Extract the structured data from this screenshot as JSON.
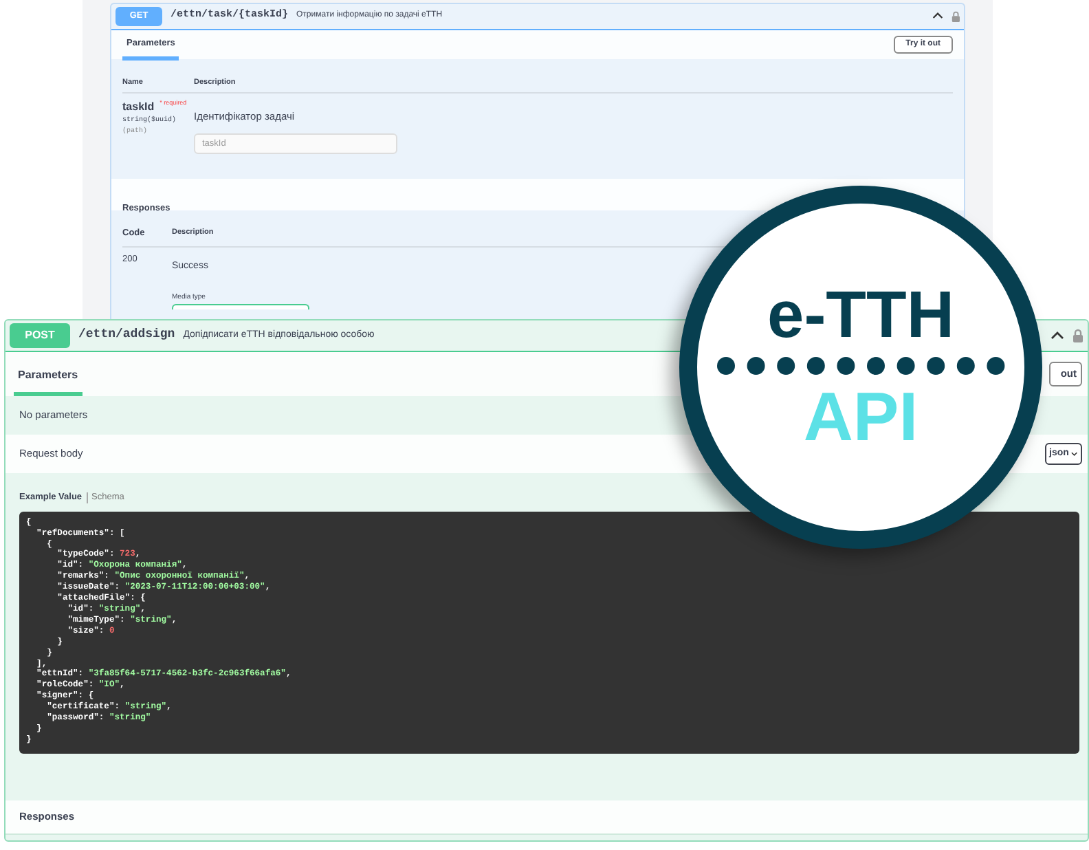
{
  "get_operation": {
    "kind": "get",
    "method": "GET",
    "path": "/ettn/task/{taskId}",
    "summary": "Отримати інформацію по задачі еТТН",
    "tab": {
      "label": "Parameters",
      "selected": true
    },
    "try_button": "Try it out",
    "param_columns": [
      "Name",
      "Description"
    ],
    "parameters": [
      {
        "name": "taskId",
        "required": "* required",
        "type": "string($uuid)",
        "location": "(path)",
        "description": "Ідентифікатор задачі",
        "placeholder": "taskId"
      }
    ],
    "responses_title": "Responses",
    "response_columns": [
      "Code",
      "Description"
    ],
    "responses": [
      {
        "code": "200",
        "description": "Success",
        "media_type_label": "Media type"
      }
    ]
  },
  "post_operation": {
    "kind": "post",
    "method": "POST",
    "path": "/ettn/addsign",
    "summary": "Допідписати еТТН відповідальною особою",
    "tab": {
      "label": "Parameters",
      "selected": true
    },
    "try_button": "out",
    "no_parameters": "No parameters",
    "request_body_title": "Request body",
    "content_type": "json",
    "example_tabs": [
      {
        "label": "Example Value",
        "selected": true
      },
      {
        "label": "Schema",
        "selected": false
      }
    ],
    "code_lines": [
      [
        {
          "kind": "plain",
          "text": "{"
        }
      ],
      [
        {
          "kind": "plain",
          "text": "  \"refDocuments\": ["
        }
      ],
      [
        {
          "kind": "plain",
          "text": "    {"
        }
      ],
      [
        {
          "kind": "plain",
          "text": "      \"typeCode\": "
        },
        {
          "kind": "number",
          "text": "723"
        },
        {
          "kind": "plain",
          "text": ","
        }
      ],
      [
        {
          "kind": "plain",
          "text": "      \"id\": "
        },
        {
          "kind": "string",
          "text": "\"Охорона компанія\""
        },
        {
          "kind": "plain",
          "text": ","
        }
      ],
      [
        {
          "kind": "plain",
          "text": "      \"remarks\": "
        },
        {
          "kind": "string",
          "text": "\"Опис охоронної компанії\""
        },
        {
          "kind": "plain",
          "text": ","
        }
      ],
      [
        {
          "kind": "plain",
          "text": "      \"issueDate\": "
        },
        {
          "kind": "string",
          "text": "\"2023-07-11T12:00:00+03:00\""
        },
        {
          "kind": "plain",
          "text": ","
        }
      ],
      [
        {
          "kind": "plain",
          "text": "      \"attachedFile\": {"
        }
      ],
      [
        {
          "kind": "plain",
          "text": "        \"id\": "
        },
        {
          "kind": "string",
          "text": "\"string\""
        },
        {
          "kind": "plain",
          "text": ","
        }
      ],
      [
        {
          "kind": "plain",
          "text": "        \"mimeType\": "
        },
        {
          "kind": "string",
          "text": "\"string\""
        },
        {
          "kind": "plain",
          "text": ","
        }
      ],
      [
        {
          "kind": "plain",
          "text": "        \"size\": "
        },
        {
          "kind": "number",
          "text": "0"
        }
      ],
      [
        {
          "kind": "plain",
          "text": "      }"
        }
      ],
      [
        {
          "kind": "plain",
          "text": "    }"
        }
      ],
      [
        {
          "kind": "plain",
          "text": "  ],"
        }
      ],
      [
        {
          "kind": "plain",
          "text": "  \"ettnId\": "
        },
        {
          "kind": "string",
          "text": "\"3fa85f64-5717-4562-b3fc-2c963f66afa6\""
        },
        {
          "kind": "plain",
          "text": ","
        }
      ],
      [
        {
          "kind": "plain",
          "text": "  \"roleCode\": "
        },
        {
          "kind": "string",
          "text": "\"IO\""
        },
        {
          "kind": "plain",
          "text": ","
        }
      ],
      [
        {
          "kind": "plain",
          "text": "  \"signer\": {"
        }
      ],
      [
        {
          "kind": "plain",
          "text": "    \"certificate\": "
        },
        {
          "kind": "string",
          "text": "\"string\""
        },
        {
          "kind": "plain",
          "text": ","
        }
      ],
      [
        {
          "kind": "plain",
          "text": "    \"password\": "
        },
        {
          "kind": "string",
          "text": "\"string\""
        }
      ],
      [
        {
          "kind": "plain",
          "text": "  }"
        }
      ],
      [
        {
          "kind": "plain",
          "text": "}"
        }
      ]
    ],
    "responses_title": "Responses"
  },
  "badge": {
    "title": "e-TTH",
    "subtitle": "API"
  }
}
